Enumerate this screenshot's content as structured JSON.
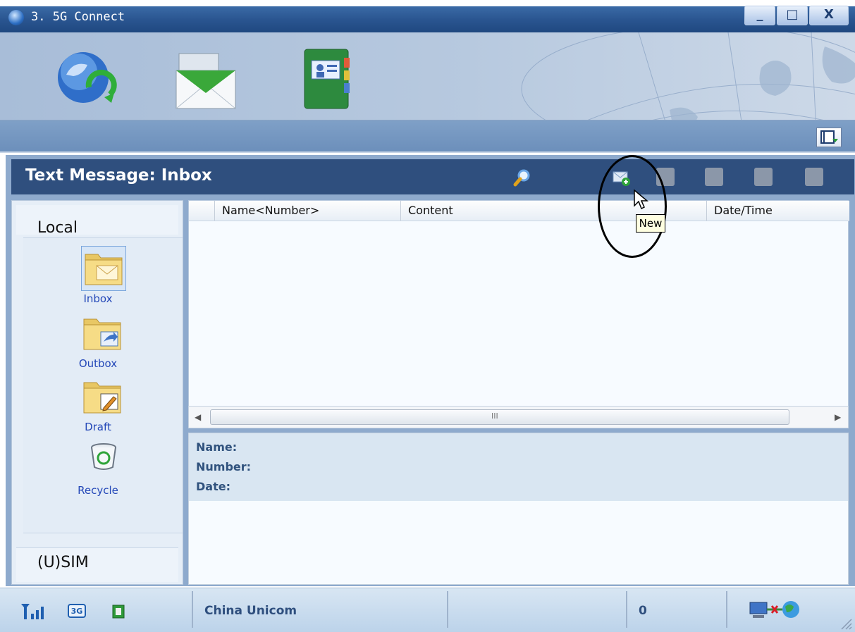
{
  "window": {
    "title": "3. 5G Connect",
    "minimize": "_",
    "maximize": "□",
    "close": "X"
  },
  "toolbar_icons": [
    "internet-connect-icon",
    "sms-envelope-icon",
    "phonebook-icon",
    "view-toggle-icon"
  ],
  "header": {
    "title": "Text Message: Inbox",
    "buttons": [
      "search-icon",
      "new-message-icon",
      "reply-icon",
      "forward-icon",
      "delete-icon",
      "move-icon"
    ]
  },
  "sidebar": {
    "local_label": "Local",
    "sim_label": "(U)SIM",
    "items": [
      {
        "label": "Inbox"
      },
      {
        "label": "Outbox"
      },
      {
        "label": "Draft"
      },
      {
        "label": "Recycle"
      }
    ]
  },
  "list": {
    "columns": [
      "Name<Number>",
      "Content",
      "Date/Time"
    ],
    "rows": [],
    "scroll_grip": "III"
  },
  "detail": {
    "name_label": "Name:",
    "number_label": "Number:",
    "date_label": "Date:"
  },
  "tooltip": "New",
  "status": {
    "icons": [
      "signal-strength-icon",
      "3g-icon",
      "sim-icon",
      "network-disconnected-icon"
    ],
    "badge_3g": "3G",
    "operator": "China Unicom",
    "count": "0"
  },
  "colors": {
    "header_bar": "#2f4f7e",
    "link_blue": "#2448b8",
    "panel_bg": "#e6eef7"
  }
}
